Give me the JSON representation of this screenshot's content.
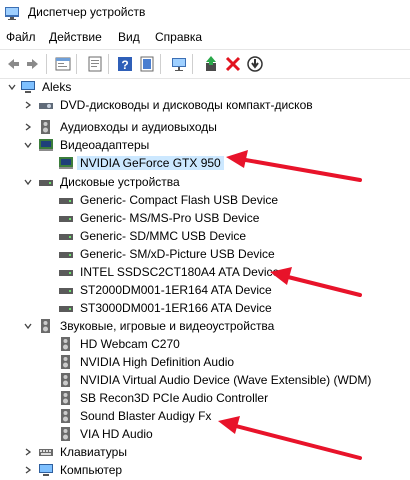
{
  "window": {
    "title": "Диспетчер устройств",
    "app_icon": "device-manager-icon"
  },
  "menu": [
    "Файл",
    "Действие",
    "Вид",
    "Справка"
  ],
  "toolbar": {
    "buttons": [
      "back-icon",
      "forward-icon",
      "properties-icon",
      "update-driver-icon",
      "help-icon",
      "show-hidden-icon",
      "scan-hardware-icon",
      "enable-device-icon",
      "uninstall-icon",
      "download-icon"
    ]
  },
  "tree": {
    "root": "Aleks",
    "categories": [
      {
        "label": "DVD-дисководы и дисководы компакт-дисков",
        "expanded": false,
        "icon": "dvd-drive-icon"
      },
      {
        "label": "Аудиовходы и аудиовыходы",
        "expanded": false,
        "icon": "speaker-icon"
      },
      {
        "label": "Видеоадаптеры",
        "expanded": true,
        "icon": "display-adapter-icon",
        "children": [
          {
            "label": "NVIDIA GeForce GTX 950",
            "selected": true
          }
        ]
      },
      {
        "label": "Дисковые устройства",
        "expanded": true,
        "icon": "disk-drive-icon",
        "children": [
          {
            "label": "Generic- Compact Flash USB Device"
          },
          {
            "label": "Generic- MS/MS-Pro USB Device"
          },
          {
            "label": "Generic- SD/MMC USB Device"
          },
          {
            "label": "Generic- SM/xD-Picture USB Device"
          },
          {
            "label": "INTEL SSDSC2CT180A4 ATA Device"
          },
          {
            "label": "ST2000DM001-1ER164 ATA Device"
          },
          {
            "label": "ST3000DM001-1ER166 ATA Device"
          }
        ]
      },
      {
        "label": "Звуковые, игровые и видеоустройства",
        "expanded": true,
        "icon": "sound-icon",
        "children": [
          {
            "label": "HD Webcam C270"
          },
          {
            "label": "NVIDIA High Definition Audio"
          },
          {
            "label": "NVIDIA Virtual Audio Device (Wave Extensible) (WDM)"
          },
          {
            "label": "SB Recon3D PCIe Audio Controller"
          },
          {
            "label": "Sound Blaster Audigy Fx"
          },
          {
            "label": "VIA HD Audio"
          }
        ]
      },
      {
        "label": "Клавиатуры",
        "expanded": false,
        "icon": "keyboard-icon"
      },
      {
        "label": "Компьютер",
        "expanded": false,
        "icon": "computer-icon"
      }
    ]
  },
  "colors": {
    "selection": "#cce8ff",
    "arrow": "#e8132a",
    "accent": "#1e6fd0"
  }
}
